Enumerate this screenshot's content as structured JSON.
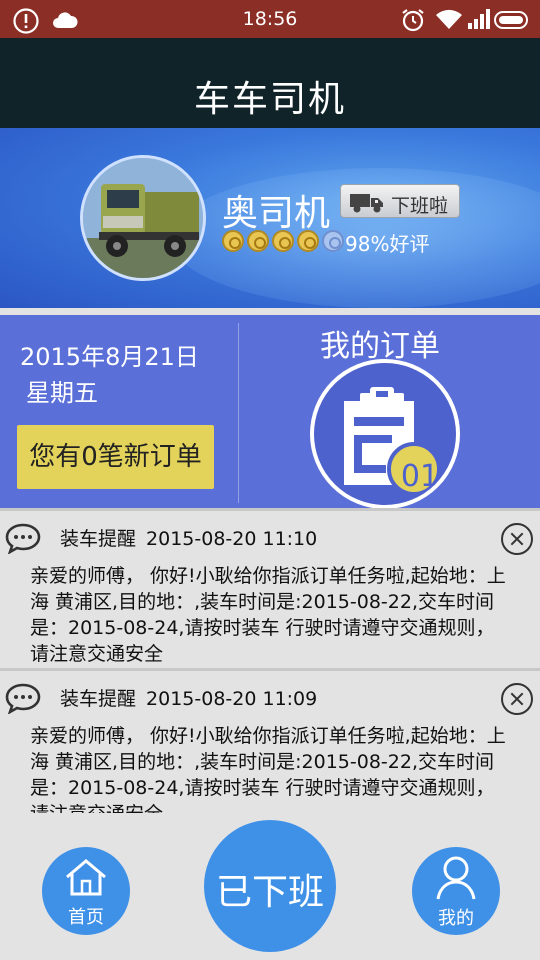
{
  "status_bar": {
    "time": "18:56",
    "icons": [
      "alert-icon",
      "cloud-icon",
      "alarm-icon",
      "wifi-icon",
      "signal-icon",
      "battery-icon"
    ]
  },
  "header": {
    "title": "车车司机"
  },
  "profile": {
    "name": "奥司机",
    "duty_button_label": "下班啦",
    "rating_text": "98%好评",
    "stars_filled": 4.5,
    "stars_total": 5
  },
  "info": {
    "date": "2015年8月21日",
    "weekday": "星期五",
    "new_orders_label": "您有0笔新订单",
    "orders_title": "我的订单",
    "orders_badge": "01"
  },
  "messages": [
    {
      "type": "装车提醒",
      "time": "2015-08-20 11:10",
      "body": "亲爱的师傅， 你好!小耿给你指派订单任务啦,起始地：上海 黄浦区,目的地：,装车时间是:2015-08-22,交车时间是：2015-08-24,请按时装车 行驶时请遵守交通规则，请注意交通安全"
    },
    {
      "type": "装车提醒",
      "time": "2015-08-20 11:09",
      "body": "亲爱的师傅， 你好!小耿给你指派订单任务啦,起始地：上海 黄浦区,目的地：,装车时间是:2015-08-22,交车时间是：2015-08-24,请按时装车 行驶时请遵守交通规则，请注意交通安全"
    }
  ],
  "bottom_nav": {
    "home_label": "首页",
    "main_label": "已下班",
    "me_label": "我的"
  },
  "colors": {
    "title_bar": "#0f2329",
    "status_bar": "#8b2e25",
    "info_panel": "#5a6fd7",
    "new_orders_button": "#e4d35a",
    "nav_button": "#3f91e8"
  }
}
